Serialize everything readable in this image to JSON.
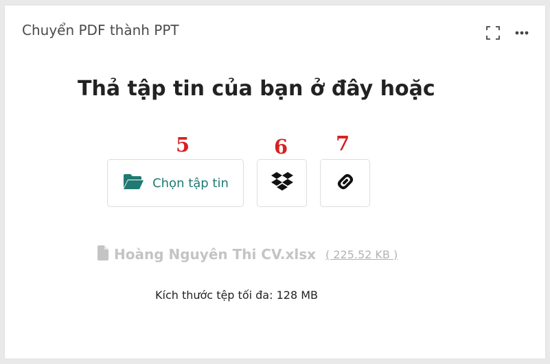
{
  "card": {
    "title": "Chuyển PDF thành PPT"
  },
  "icons": {
    "fullscreen": "fullscreen-icon",
    "more": "more-dots-icon",
    "folder": "folder-open-icon",
    "dropbox": "dropbox-icon",
    "link": "link-icon",
    "file": "file-icon"
  },
  "main": {
    "headline": "Thả tập tin của bạn ở đây hoặc",
    "markers": [
      "5",
      "6",
      "7"
    ],
    "choose_label": "Chọn tập tin",
    "file_name": "Hoàng Nguyên Thi CV.xlsx",
    "file_size": "( 225.52 KB )",
    "max_size": "Kích thước tệp tối đa: 128 MB"
  },
  "colors": {
    "accent": "#1f7a72",
    "marker": "#d62222",
    "muted": "#c4c4c4"
  }
}
